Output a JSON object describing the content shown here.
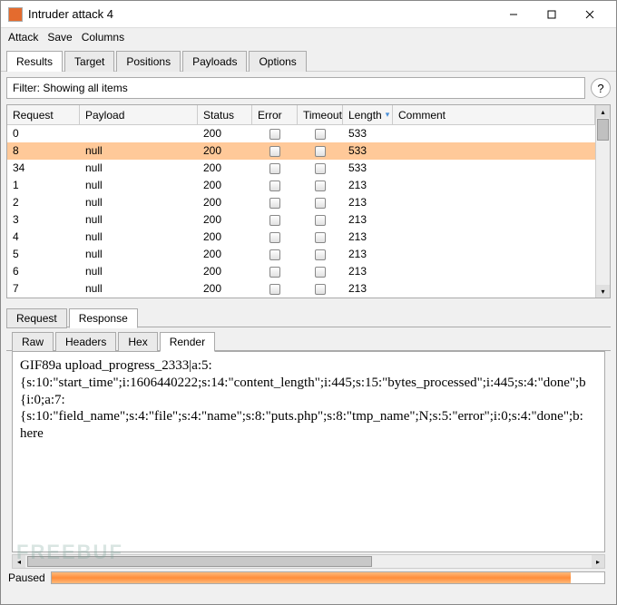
{
  "window": {
    "title": "Intruder attack 4"
  },
  "menu": {
    "items": [
      "Attack",
      "Save",
      "Columns"
    ]
  },
  "tabs": {
    "items": [
      "Results",
      "Target",
      "Positions",
      "Payloads",
      "Options"
    ],
    "active": 0
  },
  "filter": {
    "text": "Filter: Showing all items"
  },
  "table": {
    "headers": {
      "request": "Request",
      "payload": "Payload",
      "status": "Status",
      "error": "Error",
      "timeout": "Timeout",
      "length": "Length",
      "comment": "Comment"
    },
    "sort_column": "length",
    "rows": [
      {
        "request": "0",
        "payload": "",
        "status": "200",
        "error": false,
        "timeout": false,
        "length": "533",
        "comment": "",
        "selected": false
      },
      {
        "request": "8",
        "payload": "null",
        "status": "200",
        "error": false,
        "timeout": false,
        "length": "533",
        "comment": "",
        "selected": true
      },
      {
        "request": "34",
        "payload": "null",
        "status": "200",
        "error": false,
        "timeout": false,
        "length": "533",
        "comment": "",
        "selected": false
      },
      {
        "request": "1",
        "payload": "null",
        "status": "200",
        "error": false,
        "timeout": false,
        "length": "213",
        "comment": "",
        "selected": false
      },
      {
        "request": "2",
        "payload": "null",
        "status": "200",
        "error": false,
        "timeout": false,
        "length": "213",
        "comment": "",
        "selected": false
      },
      {
        "request": "3",
        "payload": "null",
        "status": "200",
        "error": false,
        "timeout": false,
        "length": "213",
        "comment": "",
        "selected": false
      },
      {
        "request": "4",
        "payload": "null",
        "status": "200",
        "error": false,
        "timeout": false,
        "length": "213",
        "comment": "",
        "selected": false
      },
      {
        "request": "5",
        "payload": "null",
        "status": "200",
        "error": false,
        "timeout": false,
        "length": "213",
        "comment": "",
        "selected": false
      },
      {
        "request": "6",
        "payload": "null",
        "status": "200",
        "error": false,
        "timeout": false,
        "length": "213",
        "comment": "",
        "selected": false
      },
      {
        "request": "7",
        "payload": "null",
        "status": "200",
        "error": false,
        "timeout": false,
        "length": "213",
        "comment": "",
        "selected": false
      }
    ]
  },
  "subtabs": {
    "items": [
      "Request",
      "Response"
    ],
    "active": 1
  },
  "viewtabs": {
    "items": [
      "Raw",
      "Headers",
      "Hex",
      "Render"
    ],
    "active": 3
  },
  "render": {
    "lines": [
      "GIF89a upload_progress_2333|a:5:",
      "{s:10:\"start_time\";i:1606440222;s:14:\"content_length\";i:445;s:15:\"bytes_processed\";i:445;s:4:\"done\";b",
      "{i:0;a:7:",
      "{s:10:\"field_name\";s:4:\"file\";s:4:\"name\";s:8:\"puts.php\";s:8:\"tmp_name\";N;s:5:\"error\";i:0;s:4:\"done\";b:",
      "here"
    ]
  },
  "status": {
    "label": "Paused"
  },
  "watermark": "FREEBUF"
}
